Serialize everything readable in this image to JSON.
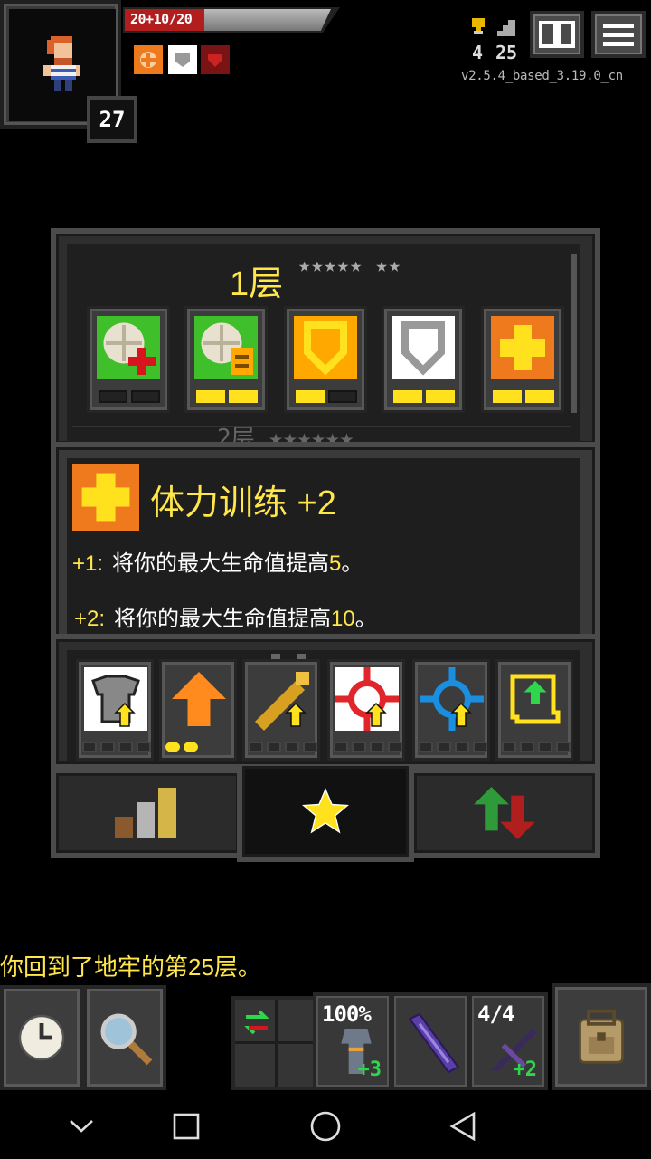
{
  "status": {
    "hp_text": "20+10/20",
    "hp_fraction": 1.0,
    "shield_fraction": 0.5,
    "hero_level": "27",
    "buffs": [
      {
        "name": "healing-icon",
        "color": "#ef7a1e"
      },
      {
        "name": "shield-icon",
        "color": "#ffffff"
      },
      {
        "name": "heart-icon",
        "color": "#7a1414"
      }
    ],
    "gold_icon": "trophy-icon",
    "gold": "4",
    "depth_icon": "stairs-icon",
    "depth": "25",
    "version": "v2.5.4_based_3.19.0_cn",
    "journal_icon": "journal-icon",
    "menu_icon": "menu-icon"
  },
  "talents": {
    "tier_title": "1层",
    "tier_stars": "★★★★★ ★★",
    "next_tier_peek": "2层 ★★★★★★",
    "items": [
      {
        "name": "talent-hearty-meal",
        "color": "#3fbf2a",
        "points": 0
      },
      {
        "name": "talent-veterans-intuition",
        "color": "#3fbf2a",
        "points": 2
      },
      {
        "name": "talent-test-subject",
        "color": "#ffa800",
        "points": 1
      },
      {
        "name": "talent-iron-will",
        "color": "#ffffff",
        "points": 2
      },
      {
        "name": "talent-strongman",
        "color": "#ef7a1e",
        "points": 2
      }
    ],
    "info": {
      "title": "体力训练 +2",
      "lines": [
        {
          "key": "+1:",
          "text": "将你的最大生命值提高",
          "num": "5",
          "end": "。"
        },
        {
          "key": "+2:",
          "text": "将你的最大生命值提高",
          "num": "10",
          "end": "。"
        }
      ]
    },
    "upgrades": [
      {
        "name": "armor-upgrade",
        "pips": 0
      },
      {
        "name": "strength-upgrade",
        "pips": 2
      },
      {
        "name": "weapon-upgrade",
        "pips": 0
      },
      {
        "name": "accuracy-upgrade",
        "pips": 0
      },
      {
        "name": "ranged-upgrade",
        "pips": 0
      },
      {
        "name": "scroll-upgrade",
        "pips": 0
      }
    ],
    "tabs": [
      "stats-tab",
      "talents-tab",
      "upgrades-tab"
    ]
  },
  "log": "你回到了地牢的第25层。",
  "toolbar": {
    "wait_icon": "clock-icon",
    "search_icon": "magnifier-icon",
    "swap_icon": "swap-icon",
    "quickslots": [
      {
        "top": "100%",
        "bottom": "+3",
        "item": "armor-item"
      },
      {
        "top": "",
        "bottom": "",
        "item": "wand-item"
      },
      {
        "top": "4/4",
        "bottom": "+2",
        "item": "crossbow-item"
      }
    ],
    "backpack_icon": "backpack-icon"
  }
}
